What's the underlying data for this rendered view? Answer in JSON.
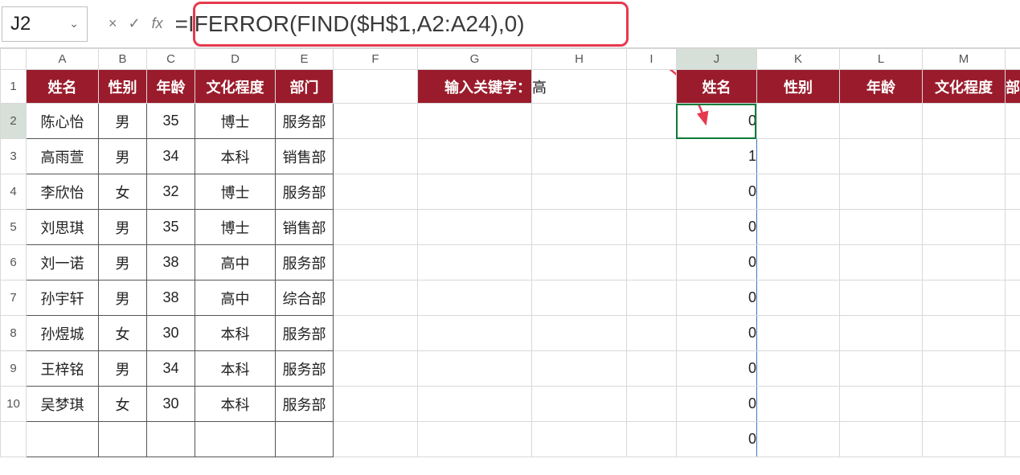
{
  "namebox": {
    "value": "J2"
  },
  "formula": {
    "text": "=IFERROR(FIND($H$1,A2:A24),0)"
  },
  "fb_icons": {
    "cancel": "×",
    "enter": "✓",
    "fx": "fx"
  },
  "columns": [
    "A",
    "B",
    "C",
    "D",
    "E",
    "F",
    "G",
    "H",
    "I",
    "J",
    "K",
    "L",
    "M",
    ""
  ],
  "rows": [
    "1",
    "2",
    "3",
    "4",
    "5",
    "6",
    "7",
    "8",
    "9",
    "10",
    ""
  ],
  "headersLeft": {
    "A": "姓名",
    "B": "性别",
    "C": "年龄",
    "D": "文化程度",
    "E": "部门"
  },
  "keywordLabel": "输入关键字：",
  "keywordValue": "高",
  "headersRight": {
    "J": "姓名",
    "K": "性别",
    "L": "年龄",
    "M": "文化程度",
    "N": "部"
  },
  "tableA": [
    {
      "name": "陈心怡",
      "sex": "男",
      "age": "35",
      "edu": "博士",
      "dept": "服务部"
    },
    {
      "name": "高雨萱",
      "sex": "男",
      "age": "34",
      "edu": "本科",
      "dept": "销售部"
    },
    {
      "name": "李欣怡",
      "sex": "女",
      "age": "32",
      "edu": "博士",
      "dept": "服务部"
    },
    {
      "name": "刘思琪",
      "sex": "男",
      "age": "35",
      "edu": "博士",
      "dept": "销售部"
    },
    {
      "name": "刘一诺",
      "sex": "男",
      "age": "38",
      "edu": "高中",
      "dept": "服务部"
    },
    {
      "name": "孙宇轩",
      "sex": "男",
      "age": "38",
      "edu": "高中",
      "dept": "综合部"
    },
    {
      "name": "孙煜城",
      "sex": "女",
      "age": "30",
      "edu": "本科",
      "dept": "服务部"
    },
    {
      "name": "王梓铭",
      "sex": "男",
      "age": "34",
      "edu": "本科",
      "dept": "服务部"
    },
    {
      "name": "吴梦琪",
      "sex": "女",
      "age": "30",
      "edu": "本科",
      "dept": "服务部"
    }
  ],
  "Jvals": [
    "0",
    "1",
    "0",
    "0",
    "0",
    "0",
    "0",
    "0",
    "0",
    "0"
  ],
  "partialRow": {
    "name": "",
    "sex": "",
    "age": "",
    "edu": "",
    "dept": ""
  }
}
